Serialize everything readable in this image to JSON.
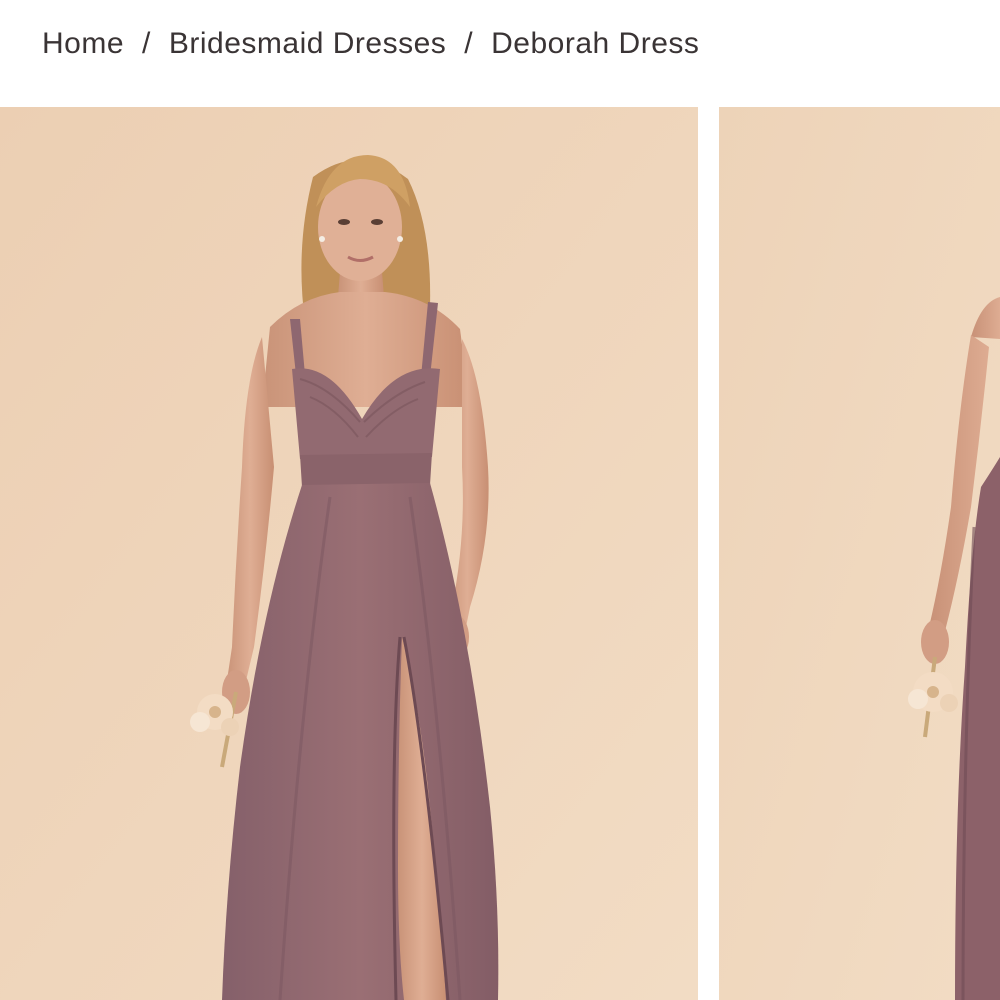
{
  "breadcrumb": {
    "items": [
      {
        "label": "Home"
      },
      {
        "label": "Bridesmaid Dresses"
      },
      {
        "label": "Deborah Dress"
      }
    ],
    "separator": "/"
  },
  "gallery": {
    "slides": [
      {
        "kind": "product-photo-front"
      },
      {
        "kind": "product-photo-side"
      }
    ]
  },
  "colors": {
    "background": "#efd6bc",
    "dress": "#94696f",
    "dress_shadow": "#7e5760",
    "skin": "#d9a78c",
    "hair": "#c89a5e",
    "text": "#3a3435"
  }
}
